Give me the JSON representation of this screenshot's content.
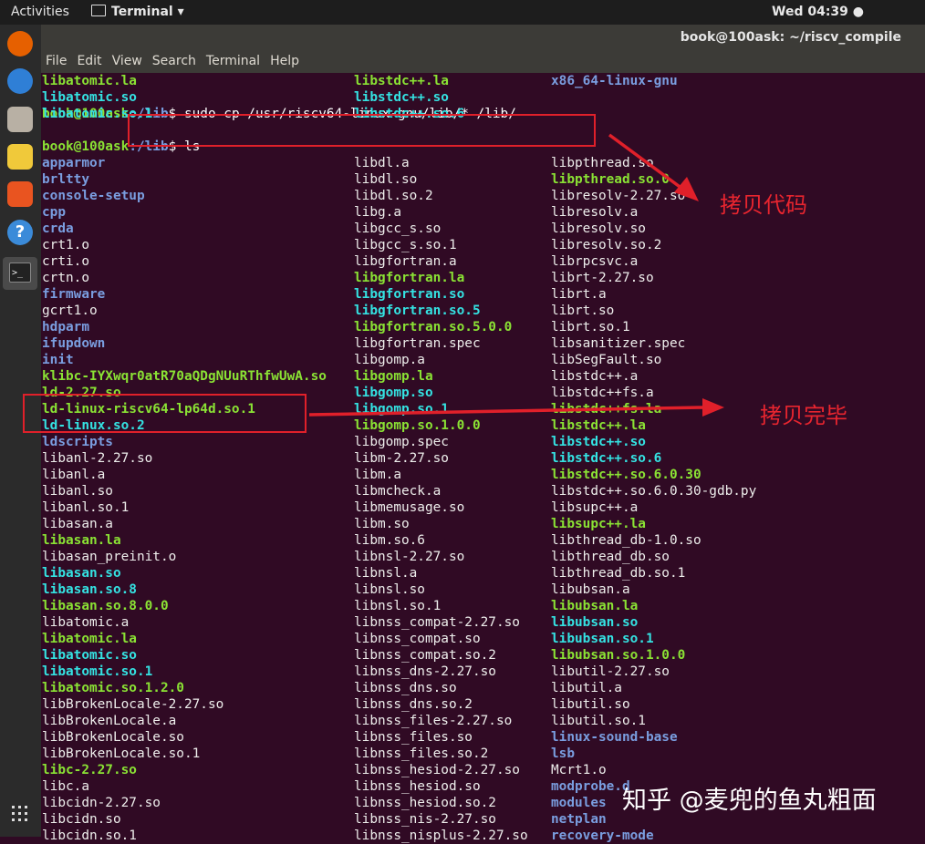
{
  "topbar": {
    "activities": "Activities",
    "app": "Terminal ▾",
    "clock": "Wed 04:39 ●"
  },
  "window": {
    "title": "book@100ask: ~/riscv_compile"
  },
  "menu": [
    "File",
    "Edit",
    "View",
    "Search",
    "Terminal",
    "Help"
  ],
  "dock": [
    "firefox-icon",
    "thunderbird-icon",
    "files-icon",
    "rhythmbox-icon",
    "software-icon",
    "help-icon",
    "terminal-icon",
    "apps-grid-icon"
  ],
  "terminal": {
    "top_rows": [
      [
        [
          "libatomic.la",
          "g"
        ],
        [
          "libstdc++.la",
          "g"
        ],
        [
          "x86_64-linux-gnu",
          "d"
        ]
      ],
      [
        [
          "libatomic.so",
          "l"
        ],
        [
          "libstdc++.so",
          "l"
        ],
        [
          "",
          ""
        ]
      ],
      [
        [
          "libatomic.so.1",
          "l"
        ],
        [
          "libstdc++.so.6",
          "l"
        ],
        [
          "",
          ""
        ]
      ]
    ],
    "prompt_user": "book@100ask",
    "prompt_path": ":/lib",
    "cmd1": "$ sudo cp /usr/riscv64-linux-gnu/lib/* /lib/",
    "cmd2": "$ ls",
    "ls_rows": [
      [
        [
          "apparmor",
          "d"
        ],
        [
          "libdl.a",
          "f"
        ],
        [
          "libpthread.so",
          "f"
        ]
      ],
      [
        [
          "brltty",
          "d"
        ],
        [
          "libdl.so",
          "f"
        ],
        [
          "libpthread.so.0",
          "g"
        ]
      ],
      [
        [
          "console-setup",
          "d"
        ],
        [
          "libdl.so.2",
          "f"
        ],
        [
          "libresolv-2.27.so",
          "f"
        ]
      ],
      [
        [
          "cpp",
          "d"
        ],
        [
          "libg.a",
          "f"
        ],
        [
          "libresolv.a",
          "f"
        ]
      ],
      [
        [
          "crda",
          "d"
        ],
        [
          "libgcc_s.so",
          "f"
        ],
        [
          "libresolv.so",
          "f"
        ]
      ],
      [
        [
          "crt1.o",
          "f"
        ],
        [
          "libgcc_s.so.1",
          "f"
        ],
        [
          "libresolv.so.2",
          "f"
        ]
      ],
      [
        [
          "crti.o",
          "f"
        ],
        [
          "libgfortran.a",
          "f"
        ],
        [
          "librpcsvc.a",
          "f"
        ]
      ],
      [
        [
          "crtn.o",
          "f"
        ],
        [
          "libgfortran.la",
          "g"
        ],
        [
          "librt-2.27.so",
          "f"
        ]
      ],
      [
        [
          "firmware",
          "d"
        ],
        [
          "libgfortran.so",
          "l"
        ],
        [
          "librt.a",
          "f"
        ]
      ],
      [
        [
          "gcrt1.o",
          "f"
        ],
        [
          "libgfortran.so.5",
          "l"
        ],
        [
          "librt.so",
          "f"
        ]
      ],
      [
        [
          "hdparm",
          "d"
        ],
        [
          "libgfortran.so.5.0.0",
          "g"
        ],
        [
          "librt.so.1",
          "f"
        ]
      ],
      [
        [
          "ifupdown",
          "d"
        ],
        [
          "libgfortran.spec",
          "f"
        ],
        [
          "libsanitizer.spec",
          "f"
        ]
      ],
      [
        [
          "init",
          "d"
        ],
        [
          "libgomp.a",
          "f"
        ],
        [
          "libSegFault.so",
          "f"
        ]
      ],
      [
        [
          "klibc-IYXwqr0atR70aQDgNUuRThfwUwA.so",
          "g"
        ],
        [
          "libgomp.la",
          "g"
        ],
        [
          "libstdc++.a",
          "f"
        ]
      ],
      [
        [
          "ld-2.27.so",
          "g"
        ],
        [
          "libgomp.so",
          "l"
        ],
        [
          "libstdc++fs.a",
          "f"
        ]
      ],
      [
        [
          "ld-linux-riscv64-lp64d.so.1",
          "g"
        ],
        [
          "libgomp.so.1",
          "l"
        ],
        [
          "libstdc++fs.la",
          "g"
        ]
      ],
      [
        [
          "ld-linux.so.2",
          "l"
        ],
        [
          "libgomp.so.1.0.0",
          "g"
        ],
        [
          "libstdc++.la",
          "g"
        ]
      ],
      [
        [
          "ldscripts",
          "d"
        ],
        [
          "libgomp.spec",
          "f"
        ],
        [
          "libstdc++.so",
          "l"
        ]
      ],
      [
        [
          "libanl-2.27.so",
          "f"
        ],
        [
          "libm-2.27.so",
          "f"
        ],
        [
          "libstdc++.so.6",
          "l"
        ]
      ],
      [
        [
          "libanl.a",
          "f"
        ],
        [
          "libm.a",
          "f"
        ],
        [
          "libstdc++.so.6.0.30",
          "g"
        ]
      ],
      [
        [
          "libanl.so",
          "f"
        ],
        [
          "libmcheck.a",
          "f"
        ],
        [
          "libstdc++.so.6.0.30-gdb.py",
          "f"
        ]
      ],
      [
        [
          "libanl.so.1",
          "f"
        ],
        [
          "libmemusage.so",
          "f"
        ],
        [
          "libsupc++.a",
          "f"
        ]
      ],
      [
        [
          "libasan.a",
          "f"
        ],
        [
          "libm.so",
          "f"
        ],
        [
          "libsupc++.la",
          "g"
        ]
      ],
      [
        [
          "libasan.la",
          "g"
        ],
        [
          "libm.so.6",
          "f"
        ],
        [
          "libthread_db-1.0.so",
          "f"
        ]
      ],
      [
        [
          "libasan_preinit.o",
          "f"
        ],
        [
          "libnsl-2.27.so",
          "f"
        ],
        [
          "libthread_db.so",
          "f"
        ]
      ],
      [
        [
          "libasan.so",
          "l"
        ],
        [
          "libnsl.a",
          "f"
        ],
        [
          "libthread_db.so.1",
          "f"
        ]
      ],
      [
        [
          "libasan.so.8",
          "l"
        ],
        [
          "libnsl.so",
          "f"
        ],
        [
          "libubsan.a",
          "f"
        ]
      ],
      [
        [
          "libasan.so.8.0.0",
          "g"
        ],
        [
          "libnsl.so.1",
          "f"
        ],
        [
          "libubsan.la",
          "g"
        ]
      ],
      [
        [
          "libatomic.a",
          "f"
        ],
        [
          "libnss_compat-2.27.so",
          "f"
        ],
        [
          "libubsan.so",
          "l"
        ]
      ],
      [
        [
          "libatomic.la",
          "g"
        ],
        [
          "libnss_compat.so",
          "f"
        ],
        [
          "libubsan.so.1",
          "l"
        ]
      ],
      [
        [
          "libatomic.so",
          "l"
        ],
        [
          "libnss_compat.so.2",
          "f"
        ],
        [
          "libubsan.so.1.0.0",
          "g"
        ]
      ],
      [
        [
          "libatomic.so.1",
          "l"
        ],
        [
          "libnss_dns-2.27.so",
          "f"
        ],
        [
          "libutil-2.27.so",
          "f"
        ]
      ],
      [
        [
          "libatomic.so.1.2.0",
          "g"
        ],
        [
          "libnss_dns.so",
          "f"
        ],
        [
          "libutil.a",
          "f"
        ]
      ],
      [
        [
          "libBrokenLocale-2.27.so",
          "f"
        ],
        [
          "libnss_dns.so.2",
          "f"
        ],
        [
          "libutil.so",
          "f"
        ]
      ],
      [
        [
          "libBrokenLocale.a",
          "f"
        ],
        [
          "libnss_files-2.27.so",
          "f"
        ],
        [
          "libutil.so.1",
          "f"
        ]
      ],
      [
        [
          "libBrokenLocale.so",
          "f"
        ],
        [
          "libnss_files.so",
          "f"
        ],
        [
          "linux-sound-base",
          "d"
        ]
      ],
      [
        [
          "libBrokenLocale.so.1",
          "f"
        ],
        [
          "libnss_files.so.2",
          "f"
        ],
        [
          "lsb",
          "d"
        ]
      ],
      [
        [
          "libc-2.27.so",
          "g"
        ],
        [
          "libnss_hesiod-2.27.so",
          "f"
        ],
        [
          "Mcrt1.o",
          "f"
        ]
      ],
      [
        [
          "libc.a",
          "f"
        ],
        [
          "libnss_hesiod.so",
          "f"
        ],
        [
          "modprobe.d",
          "d"
        ]
      ],
      [
        [
          "libcidn-2.27.so",
          "f"
        ],
        [
          "libnss_hesiod.so.2",
          "f"
        ],
        [
          "modules",
          "d"
        ]
      ],
      [
        [
          "libcidn.so",
          "f"
        ],
        [
          "libnss_nis-2.27.so",
          "f"
        ],
        [
          "netplan",
          "d"
        ]
      ],
      [
        [
          "libcidn.so.1",
          "f"
        ],
        [
          "libnss_nisplus-2.27.so",
          "f"
        ],
        [
          "recovery-mode",
          "d"
        ]
      ]
    ]
  },
  "annotations": {
    "copy_code": "拷贝代码",
    "copy_done": "拷贝完毕"
  },
  "watermark": "知乎 @麦兜的鱼丸粗面",
  "colors": {
    "accent_red": "#e0202a",
    "terminal_bg": "#300a24"
  }
}
